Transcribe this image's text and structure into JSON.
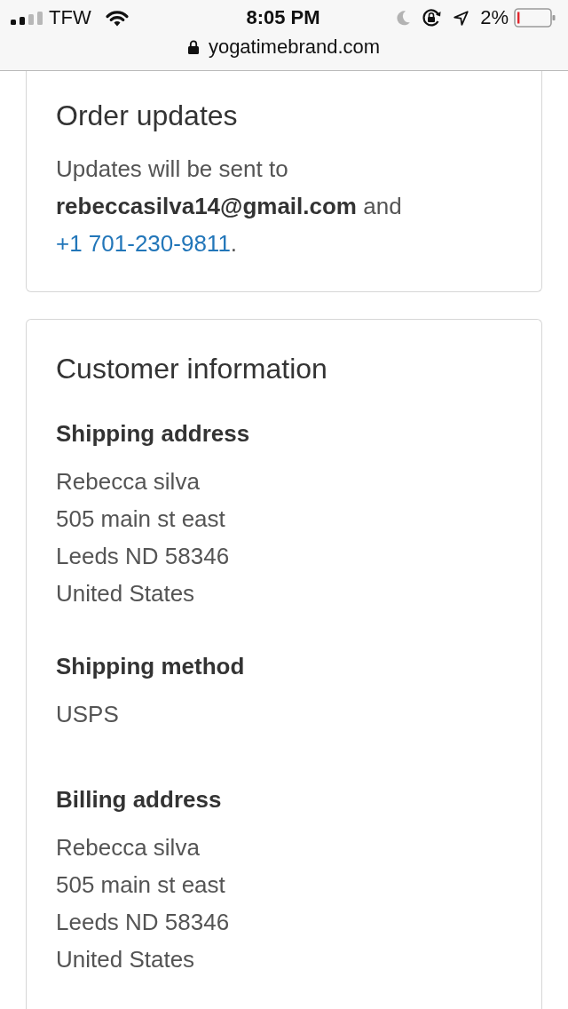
{
  "status_bar": {
    "carrier": "TFW",
    "time": "8:05 PM",
    "battery_percent": "2%",
    "url": "yogatimebrand.com"
  },
  "order_updates": {
    "title": "Order updates",
    "message": "Updates will be sent to **rebeccasilva14@gmail.com** and",
    "phone_link": "+1 701-230-9811",
    "message_end": "."
  },
  "customer_information": {
    "title": "Customer information",
    "sections": [
      {
        "kind": "address",
        "heading": "Shipping address",
        "lines": [
          "Rebecca silva",
          "505 main st east",
          "Leeds ND 58346",
          "United States"
        ]
      },
      {
        "kind": "method",
        "heading": "Shipping method",
        "lines": [
          "USPS"
        ]
      },
      {
        "kind": "address",
        "heading": "Billing address",
        "lines": [
          "Rebecca silva",
          "505 main st east",
          "Leeds ND 58346",
          "United States"
        ]
      }
    ]
  }
}
